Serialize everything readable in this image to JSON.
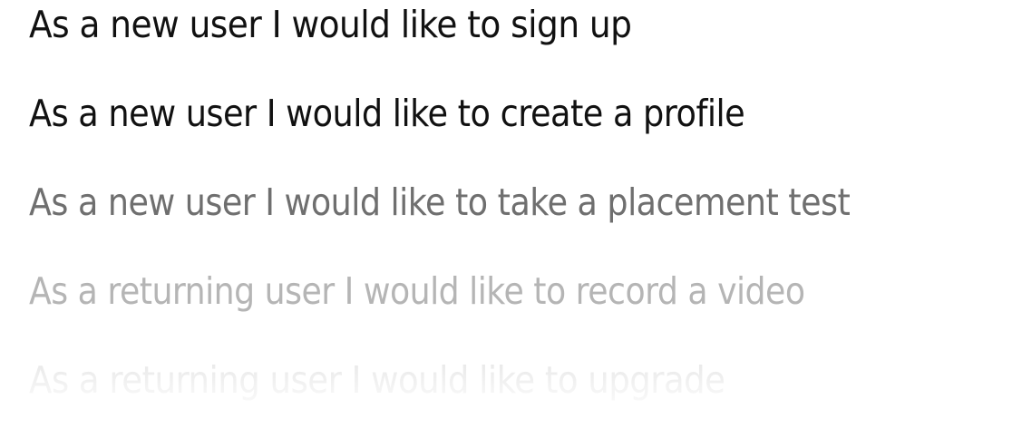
{
  "stories": [
    {
      "text": "As a new user I would like to sign up"
    },
    {
      "text": "As a new user I would like to create a profile"
    },
    {
      "text": "As a new user I would like to take a placement test"
    },
    {
      "text": "As a returning user I would like to record a video"
    },
    {
      "text": "As a returning user I would like to upgrade"
    }
  ]
}
